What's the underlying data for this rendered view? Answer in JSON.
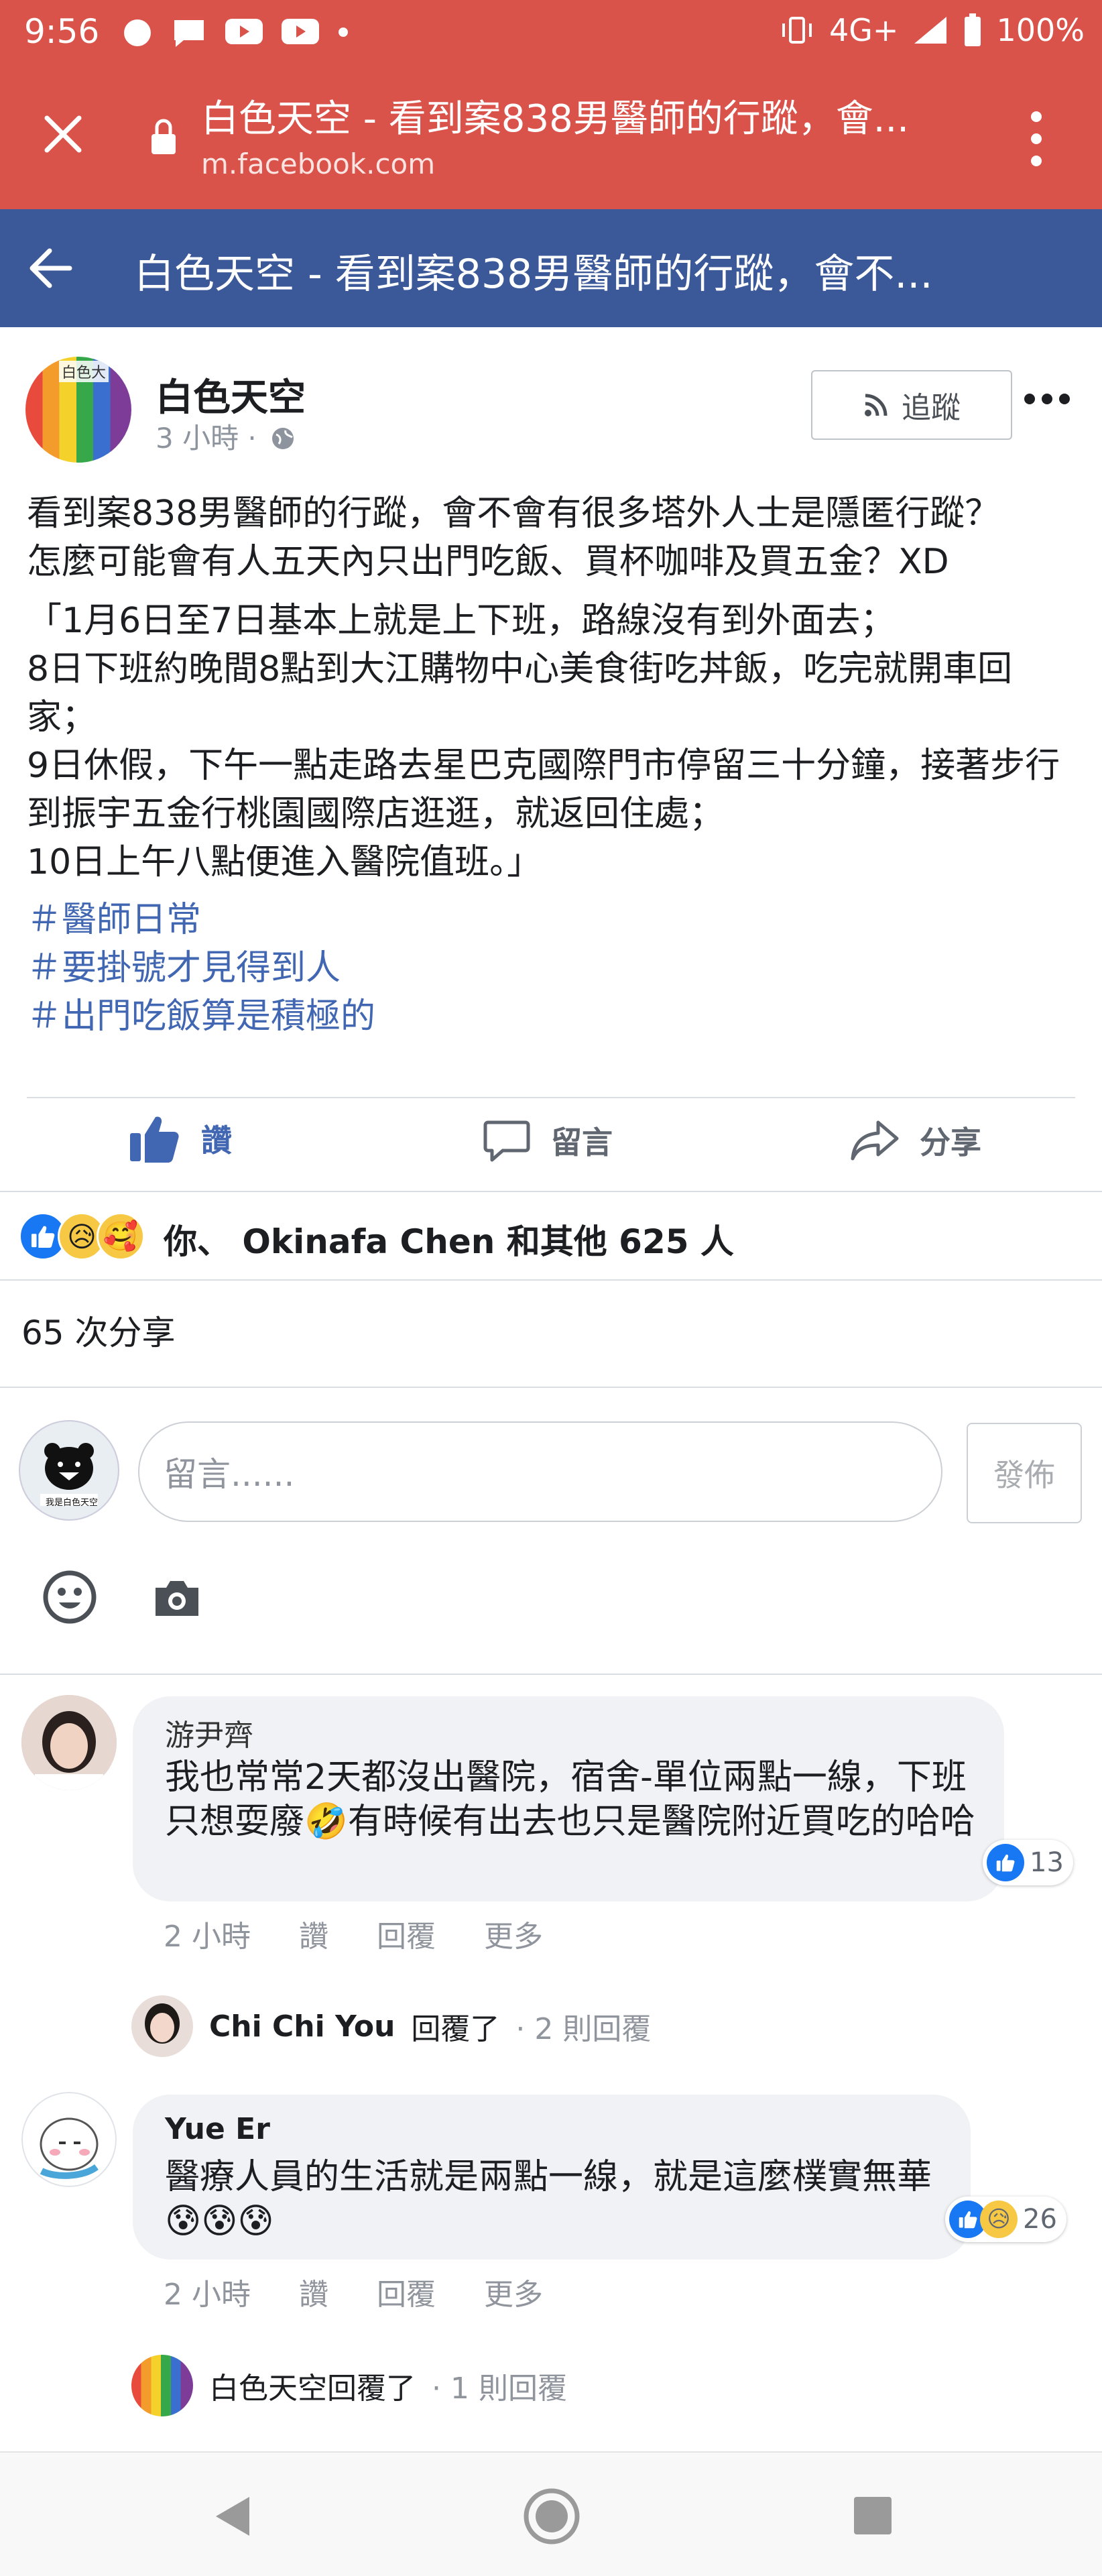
{
  "status_bar": {
    "time": "9:56",
    "signal": "4G+",
    "battery": "100%"
  },
  "browser": {
    "page_title": "白色天空 - 看到案838男醫師的行蹤，會...",
    "url": "m.facebook.com"
  },
  "fb_header": {
    "title": "白色天空 - 看到案838男醫師的行蹤，會不..."
  },
  "post": {
    "author": "白色天空",
    "avatar_tag": "白色大",
    "time": "3 小時 ·",
    "follow_label": "追蹤",
    "lines": [
      "看到案838男醫師的行蹤，會不會有很多塔外人士是隱匿行蹤？",
      "怎麼可能會有人五天內只出門吃飯、買杯咖啡及買五金？XD"
    ],
    "quote_lines": [
      "「1月6日至7日基本上就是上下班，路線沒有到外面去；",
      "8日下班約晚間8點到大江購物中心美食街吃丼飯，吃完就開車回家；",
      "9日休假，下午一點走路去星巴克國際門市停留三十分鐘，接著步行到振宇五金行桃園國際店逛逛，就返回住處；",
      "10日上午八點便進入醫院值班。」"
    ],
    "hashtags": [
      "＃醫師日常",
      "＃要掛號才見得到人",
      "＃出門吃飯算是積極的"
    ]
  },
  "actions": {
    "like": "讚",
    "comment": "留言",
    "share": "分享"
  },
  "reactions": {
    "summary": "你、 Okinafa Chen 和其他 625 人"
  },
  "share_count": "65 次分享",
  "comment_box": {
    "placeholder": "留言......",
    "post_label": "發佈",
    "my_avatar_text": "我是白色天空"
  },
  "comments": [
    {
      "name": "游尹齊",
      "text": "我也常常2天都沒出醫院，宿舍-單位兩點一線，下班只想耍廢🤣有時候有出去也只是醫院附近買吃的哈哈",
      "reaction_count": "13",
      "time": "2 小時",
      "like": "讚",
      "reply": "回覆",
      "more": "更多",
      "replies_author": "Chi Chi You",
      "replies_action": "回覆了",
      "replies_count": "· 2 則回覆"
    },
    {
      "name": "Yue Er",
      "text": "醫療人員的生活就是兩點一線，就是這麼樸實無華😰😰😰",
      "reaction_count": "26",
      "time": "2 小時",
      "like": "讚",
      "reply": "回覆",
      "more": "更多",
      "replies_author": "白色天空回覆了",
      "replies_count": "· 1 則回覆"
    }
  ],
  "colors": {
    "status": "#d9534b",
    "fb_blue": "#3b5998",
    "link": "#4267b2"
  }
}
